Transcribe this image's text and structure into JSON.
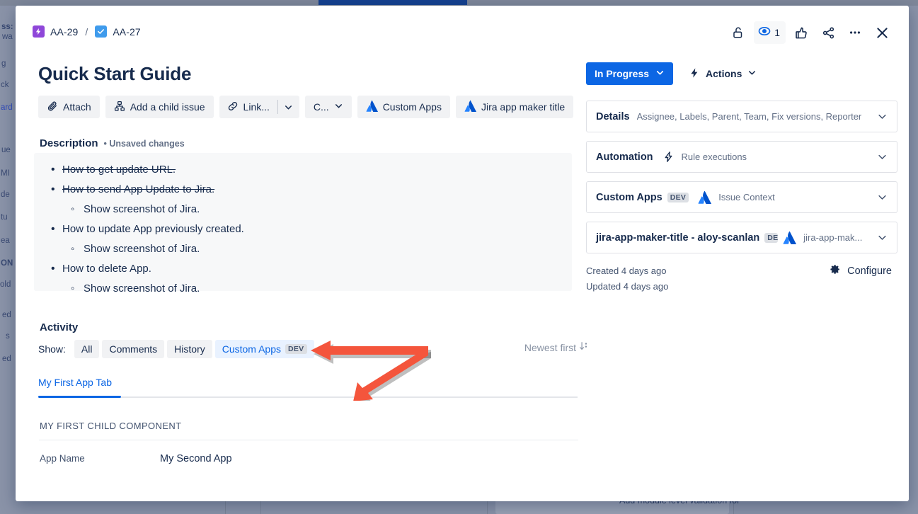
{
  "background": {
    "left_fragments": [
      {
        "text": "ss:",
        "bold": true
      },
      {
        "text": "wa",
        "bold": false
      },
      {
        "text": "g",
        "bold": false
      },
      {
        "text": "ck",
        "bold": false
      },
      {
        "text": "ard",
        "bold": false,
        "blue": true
      },
      {
        "text": "ue",
        "bold": false
      },
      {
        "text": "MI",
        "bold": false
      },
      {
        "text": "de",
        "bold": false
      },
      {
        "text": "tu",
        "bold": false
      },
      {
        "text": "ea",
        "bold": false
      },
      {
        "text": "ON",
        "bold": true
      },
      {
        "text": "old",
        "bold": false
      },
      {
        "text": "ed",
        "bold": false
      },
      {
        "text": "s",
        "bold": false
      },
      {
        "text": "ed",
        "bold": false
      }
    ],
    "bottom_text": "Add module level validation for"
  },
  "breadcrumb": {
    "parent_key": "AA-29",
    "separator": "/",
    "current_key": "AA-27",
    "parent_icon": "epic-icon",
    "current_icon": "task-icon"
  },
  "header_icons": [
    {
      "name": "unlock-icon",
      "label": "Restrict access"
    },
    {
      "name": "watch-icon",
      "label": "Watch",
      "count": "1"
    },
    {
      "name": "thumbs-up-icon",
      "label": "Vote"
    },
    {
      "name": "share-icon",
      "label": "Share"
    },
    {
      "name": "more-actions-icon",
      "label": "More actions"
    },
    {
      "name": "close-icon",
      "label": "Close"
    }
  ],
  "issue": {
    "title": "Quick Start Guide"
  },
  "actions_bar": {
    "attach": "Attach",
    "add_child": "Add a child issue",
    "link": "Link...",
    "create_truncated": "C...",
    "custom_apps": "Custom Apps",
    "jira_app_maker": "Jira app maker title"
  },
  "description": {
    "heading": "Description",
    "unsaved": "• Unsaved changes",
    "items": [
      {
        "text": "How to get update URL.",
        "level": 1,
        "struck": true
      },
      {
        "text": "How to send App Update to Jira.",
        "level": 1,
        "struck": true
      },
      {
        "text": "Show screenshot of Jira.",
        "level": 2,
        "struck": false
      },
      {
        "text": "How to update App previously created.",
        "level": 1,
        "struck": false
      },
      {
        "text": "Show screenshot of Jira.",
        "level": 2,
        "struck": false
      },
      {
        "text": "How to delete App.",
        "level": 1,
        "struck": false
      },
      {
        "text": "Show screenshot of Jira.",
        "level": 2,
        "struck": false
      }
    ]
  },
  "activity": {
    "heading": "Activity",
    "show_label": "Show:",
    "filters": [
      {
        "label": "All",
        "selected": false,
        "badge": ""
      },
      {
        "label": "Comments",
        "selected": false,
        "badge": ""
      },
      {
        "label": "History",
        "selected": false,
        "badge": ""
      },
      {
        "label": "Custom Apps",
        "selected": true,
        "badge": "DEV"
      }
    ],
    "sort": "Newest first",
    "tab": "My First App Tab",
    "child_component_heading": "MY FIRST CHILD COMPONENT",
    "field_key": "App Name",
    "field_value": "My Second App"
  },
  "right": {
    "status": "In Progress",
    "actions": "Actions",
    "panels": [
      {
        "title": "Details",
        "subtitle": "Assignee, Labels, Parent, Team, Fix versions, Reporter",
        "badge": "",
        "icon": ""
      },
      {
        "title": "Automation",
        "subtitle": "Rule executions",
        "badge": "",
        "icon": "lightning-icon"
      },
      {
        "title": "Custom Apps",
        "subtitle": "Issue Context",
        "badge": "DEV",
        "icon": "atlassian-icon"
      },
      {
        "title": "jira-app-maker-title - aloy-scanlan",
        "subtitle": "jira-app-mak...",
        "badge": "DEV",
        "icon": "atlassian-icon"
      }
    ],
    "created": "Created 4 days ago",
    "updated": "Updated 4 days ago",
    "configure": "Configure"
  },
  "colors": {
    "accent_blue": "#0c66e4",
    "text_primary": "#172b4d",
    "text_subtle": "#626f86",
    "epic_purple": "#8f47d9",
    "task_blue": "#3f9bec",
    "annotation_red": "#f4553c",
    "panel_border": "#dfe1e6",
    "button_bg": "#f1f2f4",
    "selected_bg": "#e9f2ff"
  }
}
